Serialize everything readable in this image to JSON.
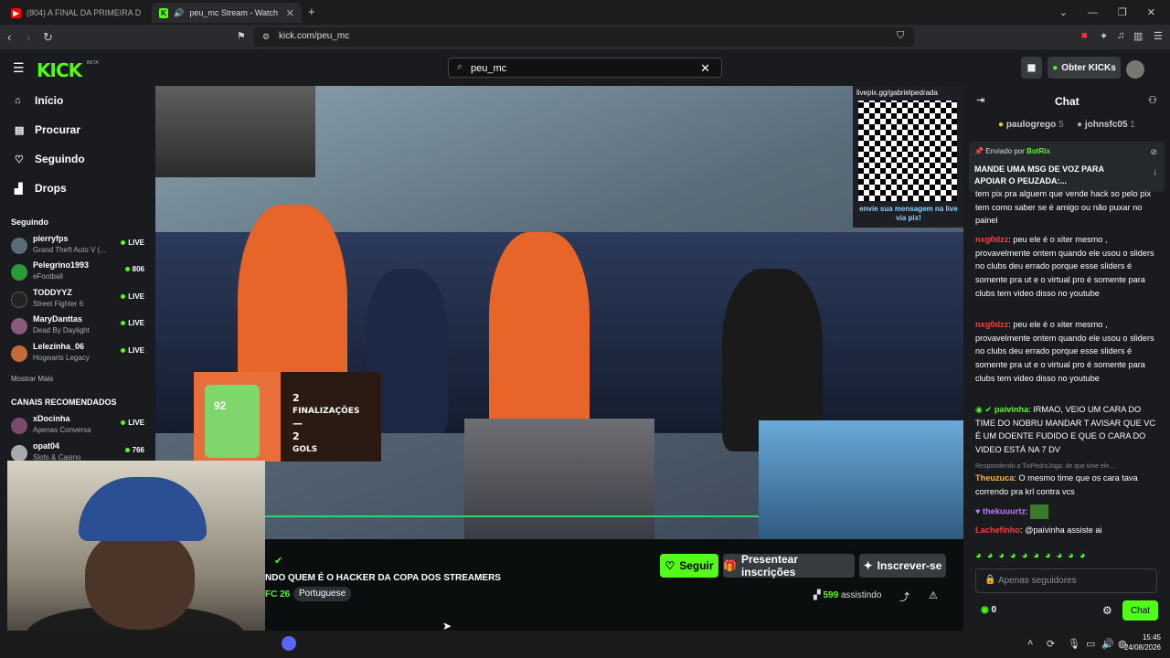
{
  "browser": {
    "tabs": [
      {
        "label": "(804) A FINAL DA PRIMEIRA DIVISÃO",
        "icon": "youtube-icon"
      },
      {
        "label": "peu_mc Stream - Watch Live",
        "icon": "kick-icon"
      }
    ],
    "new_tab": "+",
    "url": "kick.com/peu_mc"
  },
  "header": {
    "logo": "KICK",
    "beta": "BETA",
    "search_value": "peu_mc",
    "get_kicks": "Obter KICKs"
  },
  "sidebar": {
    "nav": [
      {
        "label": "Início",
        "icon": "home-icon"
      },
      {
        "label": "Procurar",
        "icon": "browse-icon"
      },
      {
        "label": "Seguindo",
        "icon": "heart-icon"
      },
      {
        "label": "Drops",
        "icon": "drops-icon"
      }
    ],
    "following_title": "Seguindo",
    "following": [
      {
        "name": "pierryfps",
        "game": "Grand Theft Auto V (...",
        "status": "LIVE",
        "color": "#5b6b7a"
      },
      {
        "name": "Pelegrino1993",
        "game": "eFootball",
        "status": "806",
        "color": "#2a9a3a"
      },
      {
        "name": "TODDYYZ",
        "game": "Street Fighter 6",
        "status": "LIVE",
        "color": "#222222"
      },
      {
        "name": "MaryDanttas",
        "game": "Dead By Daylight",
        "status": "LIVE",
        "color": "#8a5a7a"
      },
      {
        "name": "Lelezinha_06",
        "game": "Hogwarts Legacy",
        "status": "LIVE",
        "color": "#c46a3a"
      }
    ],
    "show_more": "Mostrar Mais",
    "recommended_title": "CANAIS RECOMENDADOS",
    "recommended": [
      {
        "name": "xDocinha",
        "game": "Apenas Conversa",
        "status": "LIVE",
        "color": "#7a4a6a"
      },
      {
        "name": "opat04",
        "game": "Slots & Casino",
        "status": "766",
        "color": "#aaaaaa"
      }
    ]
  },
  "video": {
    "qr_top": "livepix.gg/gabrielpedrada",
    "qr_bottom": "envie sua mensagem na live via pix!",
    "stat_rating": "92",
    "stat_text": [
      "2",
      "FINALIZAÇÕES",
      "—",
      "2",
      "GOLS"
    ]
  },
  "stream": {
    "title": "NDO QUEM É O HACKER DA COPA DOS STREAMERS",
    "category": "FC 26",
    "language": "Portuguese",
    "follow": "Seguir",
    "gift": "Presentear inscrições",
    "subscribe": "Inscrever-se",
    "viewers": "599",
    "viewers_label": "assistindo"
  },
  "chat": {
    "title": "Chat",
    "gifters": [
      {
        "name": "paulogrego",
        "count": "5"
      },
      {
        "name": "johnsfc05",
        "count": "1"
      }
    ],
    "pinned_prefix": "Enviado por",
    "pinned_user": "BotRix",
    "pinned_msg": "MANDE UMA MSG DE VOZ PARA APOIAR O PEUZADA:...",
    "messages": [
      {
        "user": "",
        "text": "tem pix pra alguem que vende hack so pelo pix tem como saber se é amigo ou não puxar no painel",
        "color": "#ffffff"
      },
      {
        "user": "nxg0dzz",
        "text": "peu ele é o xiter mesmo , provavelmente ontem quando ele usou o sliders no clubs deu errado porque esse sliders é somente pra ut e o virtual pro é somente para clubs tem video disso no youtube",
        "color": "#ff3b3b"
      },
      {
        "user": "nxg0dzz",
        "text": "peu ele é o xiter mesmo , provavelmente ontem quando ele usou o sliders no clubs deu errado porque esse sliders é somente pra ut e o virtual pro é somente para clubs tem video disso no youtube",
        "color": "#ff3b3b"
      },
      {
        "user": "paivinha",
        "text": "IRMAO, VEIO UM CARA DO TIME DO NOBRU MANDAR T AVISAR QUE VC É UM DOENTE FUDIDO E QUE O CARA DO VIDEO ESTÁ NA 7 DV",
        "color": "#53fc18"
      }
    ],
    "reply_note": "Respondendo a TioPedroJoga: de que time ele...",
    "msg_after_reply": {
      "user": "Theuzuca",
      "text": "O mesmo time que os cara tava correndo pra krl contra vcs",
      "color": "#ffb13b"
    },
    "msg_emote": {
      "user": "thekuuurtz",
      "text": "",
      "color": "#c07cff"
    },
    "msg_last": {
      "user": "Lachefinho",
      "text": "@paivinha assiste ai",
      "color": "#ff3b3b"
    },
    "input_placeholder": "Apenas seguidores",
    "kicks": "0",
    "send": "Chat"
  },
  "taskbar": {
    "time": "15:45",
    "date": "24/08/2026"
  }
}
